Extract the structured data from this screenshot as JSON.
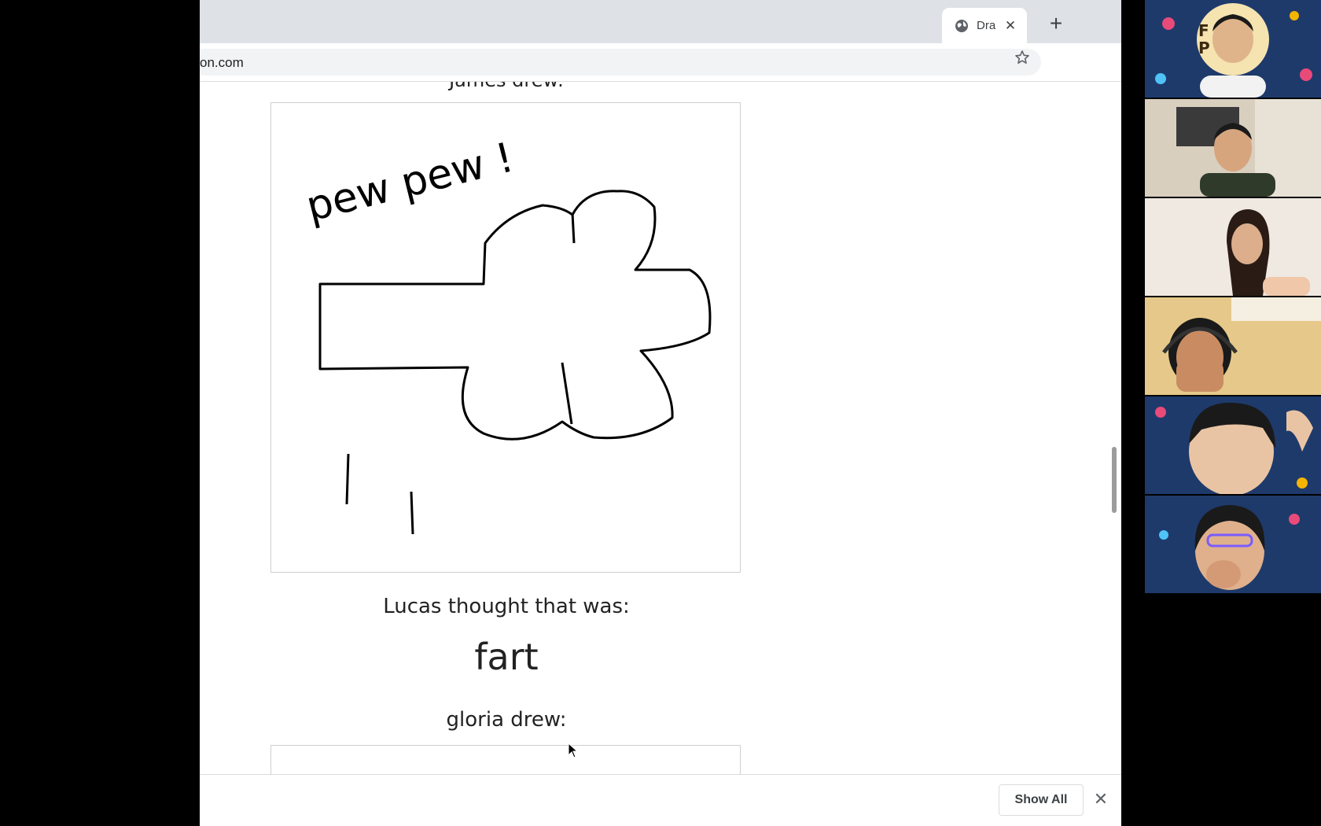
{
  "browser": {
    "tab": {
      "title": "Dra",
      "close": "✕",
      "new_tab": "+"
    },
    "address_bar": {
      "url": "on.com"
    },
    "downloads_bar": {
      "show_all_label": "Show All",
      "close": "✕"
    }
  },
  "game": {
    "top_caption": "James drew:",
    "drawing_text": "pew pew !",
    "guesser_caption": "Lucas thought that was:",
    "guess": "fart",
    "next_caption": "gloria drew:"
  },
  "video_call": {
    "logo_text": [
      "F",
      "P"
    ],
    "tile_count": 6
  },
  "colors": {
    "tabstrip": "#dee1e6",
    "background": "#000000",
    "call_pattern": "#1e3a6b"
  }
}
